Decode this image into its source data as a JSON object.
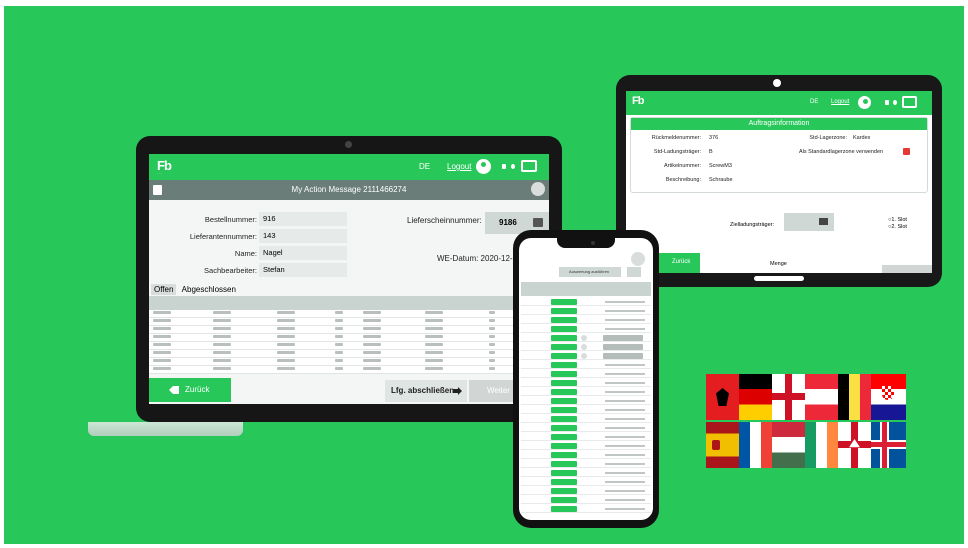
{
  "laptop": {
    "app": {
      "logo": "Fb",
      "language": "DE",
      "logout": "Logout",
      "title": "My Action Message 2111466274"
    },
    "fields": [
      {
        "label": "Bestellnummer:",
        "value": "916"
      },
      {
        "label": "Lieferantennummer:",
        "value": "143"
      },
      {
        "label": "Name:",
        "value": "Nagel"
      },
      {
        "label": "Sachbearbeiter:",
        "value": "Stefan"
      }
    ],
    "lieferschein_label": "Lieferscheinnummer:",
    "lieferschein_value": "9186",
    "we_datum": "WE-Datum: 2020-12-21",
    "tabs": [
      "Offen",
      "Abgeschlossen"
    ],
    "buttons": {
      "back": "Zurück",
      "close": "Lfg. abschließen",
      "next": "Weiter"
    }
  },
  "tablet": {
    "logo": "Fb",
    "language": "DE",
    "logout": "Logout",
    "section_title": "Auftragsinformation",
    "left_fields": [
      {
        "label": "Rückmeldenummer:",
        "value": "376"
      },
      {
        "label": "Std-Ladungsträger:",
        "value": "B"
      },
      {
        "label": "Artikelnummer:",
        "value": "ScrewM3"
      },
      {
        "label": "Beschreibung:",
        "value": "Schraube"
      }
    ],
    "right_fields": [
      {
        "label": "Std-Lagerzone:",
        "value": "Kardex"
      },
      {
        "label": "Als Standardlagerzone verwenden",
        "value": ""
      }
    ],
    "zielladung_label": "Zielladungsträger:",
    "slots": [
      "1. Slot",
      "2. Slot"
    ],
    "back": "Zurück",
    "menge": "Menge"
  },
  "phone": {
    "run_button": "Auswertung ausführen"
  },
  "colors": {
    "brand_green": "#27c75a",
    "header_gray": "#6b7d78"
  },
  "flags": [
    "Albania",
    "Germany",
    "England",
    "Austria",
    "Belgium",
    "Croatia",
    "Spain",
    "France",
    "Hungary",
    "Ireland",
    "Northern Ireland",
    "Iceland"
  ]
}
